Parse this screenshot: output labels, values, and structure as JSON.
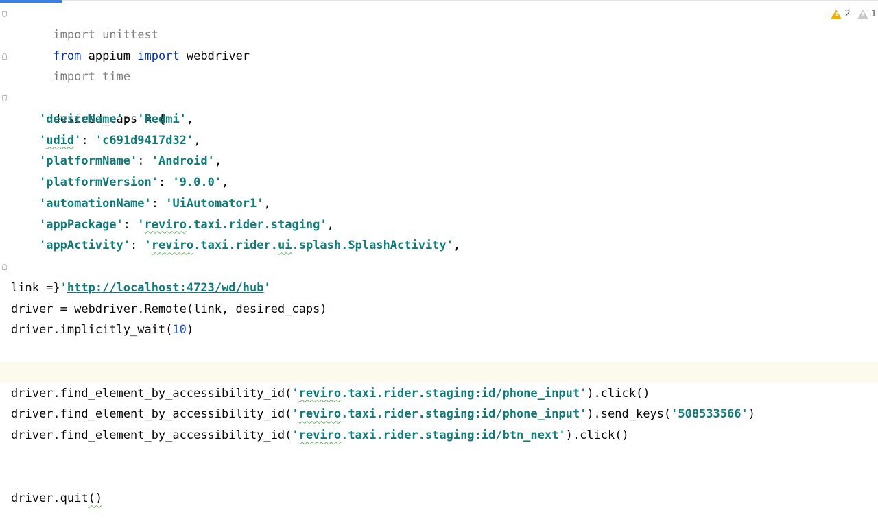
{
  "inspections": {
    "warnings": "2",
    "weak_warnings": "1"
  },
  "code": {
    "l1": {
      "kw": "import",
      "mod": " unittest"
    },
    "l2": {
      "kw1": "from",
      "mod": " appium ",
      "kw2": "import",
      "name": " webdriver"
    },
    "l3": {
      "kw": "import",
      "mod": " time"
    },
    "l5": {
      "text": "desired_caps = {"
    },
    "l6": {
      "indent": "    ",
      "key": "'deviceName'",
      "sep": ": ",
      "val": "'Redmi'",
      "end": ","
    },
    "l7": {
      "indent": "    ",
      "key_q1": "'",
      "key_w": "udid",
      "key_q2": "'",
      "sep": ": ",
      "val": "'c691d9417d32'",
      "end": ","
    },
    "l8": {
      "indent": "    ",
      "key": "'platformName'",
      "sep": ": ",
      "val": "'Android'",
      "end": ","
    },
    "l9": {
      "indent": "    ",
      "key": "'platformVersion'",
      "sep": ": ",
      "val": "'9.0.0'",
      "end": ","
    },
    "l10": {
      "indent": "    ",
      "key": "'automationName'",
      "sep": ": ",
      "val": "'UiAutomator1'",
      "end": ","
    },
    "l11": {
      "indent": "    ",
      "key": "'appPackage'",
      "sep": ": ",
      "val_q": "'",
      "val_w": "reviro",
      "val_rest": ".taxi.rider.staging'",
      "end": ","
    },
    "l12": {
      "indent": "    ",
      "key": "'appActivity'",
      "sep": ": ",
      "val_q": "'",
      "val_w": "reviro",
      "val_mid": ".taxi.rider.",
      "val_w2": "ui",
      "val_rest": ".splash.SplashActivity'",
      "end": ","
    },
    "l13": {
      "text": "}"
    },
    "l14": {
      "pre": "link = ",
      "q1": "'",
      "url": "http://localhost:4723/wd/hub",
      "q2": "'"
    },
    "l15": {
      "text": "driver = webdriver.Remote(link, desired_caps)"
    },
    "l16": {
      "pre": "driver.implicitly_wait(",
      "num": "10",
      "post": ")"
    },
    "l19": {
      "pre": "driver.find_element_by_accessibility_id(",
      "q": "'",
      "w": "reviro",
      "rest": ".taxi.rider.staging:id/phone_input'",
      "post": ").click()"
    },
    "l20": {
      "pre": "driver.find_element_by_accessibility_id(",
      "q": "'",
      "w": "reviro",
      "rest": ".taxi.rider.staging:id/phone_input'",
      "mid": ").send_keys(",
      "arg": "'508533566'",
      "post": ")"
    },
    "l21": {
      "pre": "driver.find_element_by_accessibility_id(",
      "q": "'",
      "w": "reviro",
      "rest": ".taxi.rider.staging:id/btn_next'",
      "post": ").click()"
    },
    "l24": {
      "pre": "driver.quit",
      "paren": "()"
    }
  }
}
